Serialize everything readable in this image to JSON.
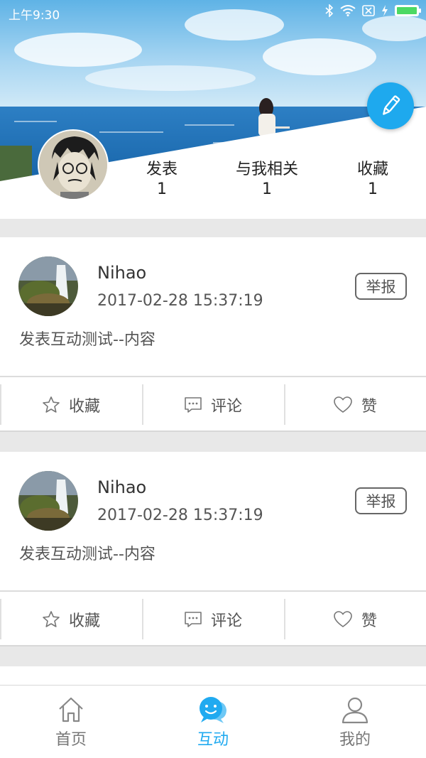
{
  "status_bar": {
    "time": "上午9:30"
  },
  "profile": {
    "stats": [
      {
        "label": "发表",
        "value": "1"
      },
      {
        "label": "与我相关",
        "value": "1"
      },
      {
        "label": "收藏",
        "value": "1"
      }
    ]
  },
  "posts": [
    {
      "username": "Nihao",
      "time": "2017-02-28 15:37:19",
      "report_label": "举报",
      "content": "发表互动测试--内容",
      "actions": {
        "favorite": "收藏",
        "comment": "评论",
        "like": "赞"
      }
    },
    {
      "username": "Nihao",
      "time": "2017-02-28 15:37:19",
      "report_label": "举报",
      "content": "发表互动测试--内容",
      "actions": {
        "favorite": "收藏",
        "comment": "评论",
        "like": "赞"
      }
    }
  ],
  "tabbar": {
    "active": "interact",
    "tabs": [
      {
        "label": "首页",
        "icon": "home-icon"
      },
      {
        "label": "互动",
        "icon": "chat-bubbles-icon"
      },
      {
        "label": "我的",
        "icon": "user-icon"
      }
    ]
  },
  "colors": {
    "accent": "#20aaf0",
    "fab": "#1ea9ee",
    "battery": "#4cd964"
  }
}
